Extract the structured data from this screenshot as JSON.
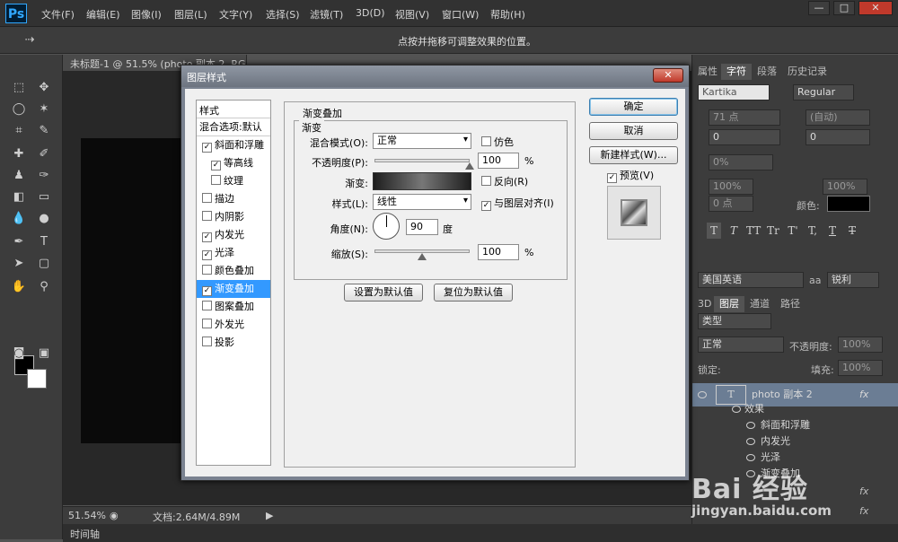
{
  "menubar": {
    "logo": "Ps",
    "items": [
      "文件(F)",
      "编辑(E)",
      "图像(I)",
      "图层(L)",
      "文字(Y)",
      "选择(S)",
      "滤镜(T)",
      "3D(D)",
      "视图(V)",
      "窗口(W)",
      "帮助(H)"
    ],
    "window_buttons": {
      "minimize": "—",
      "maximize": "□",
      "close": "✕"
    }
  },
  "options_bar": {
    "hint": "点按并拖移可调整效果的位置。"
  },
  "document_tab": {
    "label": "未标题-1 @ 51.5% (photo 副本 2, RGB/8) *"
  },
  "status_bar": {
    "zoom": "51.54%",
    "doc_info": "文档:2.64M/4.89M"
  },
  "timeline": {
    "label": "时间轴"
  },
  "right_panel": {
    "tabs_top": [
      "属性",
      "字符",
      "段落",
      "历史记录"
    ],
    "font_family": "Kartika",
    "font_style": "Regular",
    "font_size": "71 点",
    "leading": "(自动)",
    "kerning": "0",
    "tracking": "0",
    "vscale": "0%",
    "hscale": "100%",
    "vscale2": "100%",
    "baseline": "0 点",
    "color_label": "颜色:",
    "type_buttons": [
      "T",
      "T",
      "TT",
      "Tr",
      "T'",
      "T,",
      "T",
      "T"
    ],
    "language": "美国英语",
    "aa_label": "aa",
    "antialias": "锐利",
    "tabs_layers": [
      "3D",
      "图层",
      "通道",
      "路径"
    ],
    "filter_kind": "类型",
    "blend_mode": "正常",
    "opacity_label": "不透明度:",
    "opacity_value": "100%",
    "lock_label": "锁定:",
    "fill_label": "填充:",
    "fill_value": "100%",
    "layers": [
      {
        "name": "photo 副本 2",
        "fx": "fx"
      },
      {
        "name": "效果"
      },
      {
        "name": "斜面和浮雕"
      },
      {
        "name": "内发光"
      },
      {
        "name": "光泽"
      },
      {
        "name": "渐变叠加"
      }
    ],
    "fx_marks": [
      "fx",
      "fx"
    ]
  },
  "watermark": {
    "logo": "Bai 经验",
    "url": "jingyan.baidu.com"
  },
  "dialog": {
    "title": "图层样式",
    "close": "✕",
    "style_list": {
      "header": "样式",
      "blend_options": "混合选项:默认",
      "items": [
        {
          "label": "斜面和浮雕",
          "checked": "✓"
        },
        {
          "label": "等高线",
          "checked": "✓",
          "sub": true
        },
        {
          "label": "纹理",
          "checked": "",
          "sub": true
        },
        {
          "label": "描边",
          "checked": ""
        },
        {
          "label": "内阴影",
          "checked": ""
        },
        {
          "label": "内发光",
          "checked": "✓"
        },
        {
          "label": "光泽",
          "checked": "✓"
        },
        {
          "label": "颜色叠加",
          "checked": ""
        },
        {
          "label": "渐变叠加",
          "checked": "✓",
          "selected": true
        },
        {
          "label": "图案叠加",
          "checked": ""
        },
        {
          "label": "外发光",
          "checked": ""
        },
        {
          "label": "投影",
          "checked": ""
        }
      ]
    },
    "gradient_overlay": {
      "title": "渐变叠加",
      "subtitle": "渐变",
      "blend_mode_label": "混合模式(O):",
      "blend_mode": "正常",
      "dither_label": "仿色",
      "opacity_label": "不透明度(P):",
      "opacity": "100",
      "percent": "%",
      "gradient_label": "渐变:",
      "reverse_label": "反向(R)",
      "style_label": "样式(L):",
      "style": "线性",
      "align_label": "与图层对齐(I)",
      "align_checked": "✓",
      "angle_label": "角度(N):",
      "angle": "90",
      "degree": "度",
      "scale_label": "缩放(S):",
      "scale": "100",
      "scale_percent": "%",
      "opacity_level": 1.0,
      "scale_level": 0.5,
      "set_default": "设置为默认值",
      "reset_default": "复位为默认值"
    },
    "buttons": {
      "ok": "确定",
      "cancel": "取消",
      "new_style": "新建样式(W)...",
      "preview_check": "✓",
      "preview_label": "预览(V)"
    }
  }
}
